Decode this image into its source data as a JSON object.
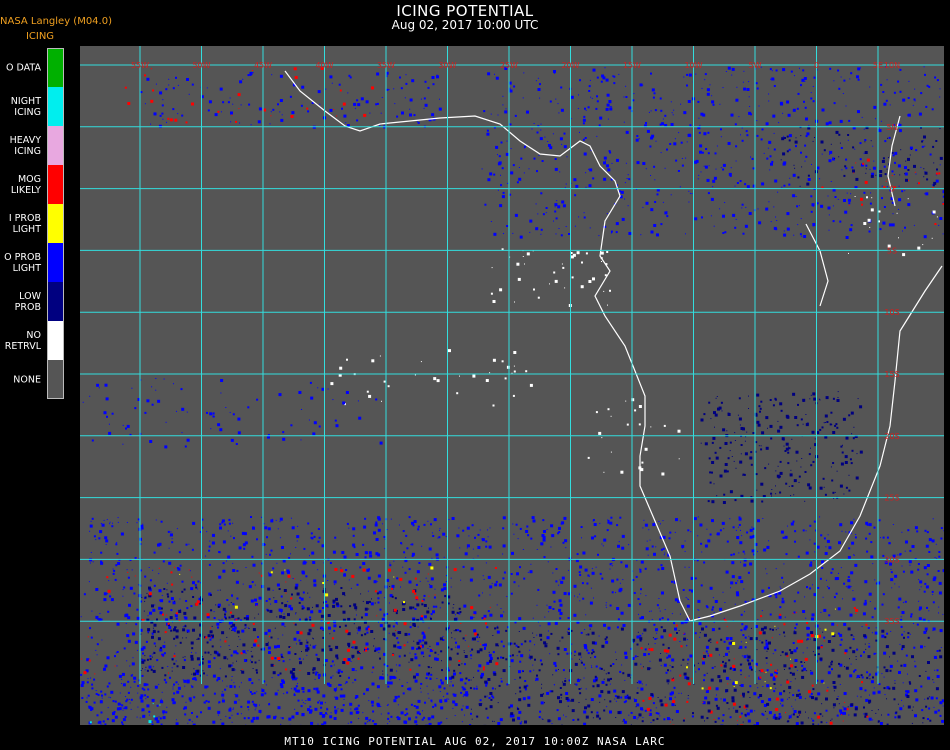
{
  "header": {
    "org_label": "NASA Langley (M04.0)",
    "legend_title": "ICING",
    "title": "ICING POTENTIAL",
    "subtitle": "Aug 02, 2017 10:00 UTC"
  },
  "legend": [
    {
      "label": "O DATA",
      "color": "#00b000"
    },
    {
      "label": "NIGHT\nICING",
      "color": "#00eeee"
    },
    {
      "label": "HEAVY\nICING",
      "color": "#e8a8e0"
    },
    {
      "label": "MOG\nLIKELY",
      "color": "#ff0000"
    },
    {
      "label": "I PROB\nLIGHT",
      "color": "#ffff00"
    },
    {
      "label": "O PROB\nLIGHT",
      "color": "#0000ff"
    },
    {
      "label": "LOW\nPROB",
      "color": "#000080"
    },
    {
      "label": "NO\nRETRVL",
      "color": "#ffffff"
    },
    {
      "label": "NONE",
      "color": "#555555"
    }
  ],
  "map": {
    "background_color": "#555555",
    "grid_color": "#33dddd",
    "grid_label_color": "#cc2222",
    "top_labels": [
      "55W",
      "50W",
      "45W",
      "40W",
      "35W",
      "30W",
      "25W",
      "20W",
      "15W",
      "10W",
      "5W",
      "0",
      "5E"
    ],
    "right_labels": [
      "10N",
      "5N",
      "0",
      "5S",
      "10S",
      "15S",
      "20S",
      "25S",
      "30S",
      "35S"
    ]
  },
  "footer": {
    "text": "MT10   ICING POTENTIAL    AUG 02, 2017 10:00Z    NASA LARC"
  }
}
